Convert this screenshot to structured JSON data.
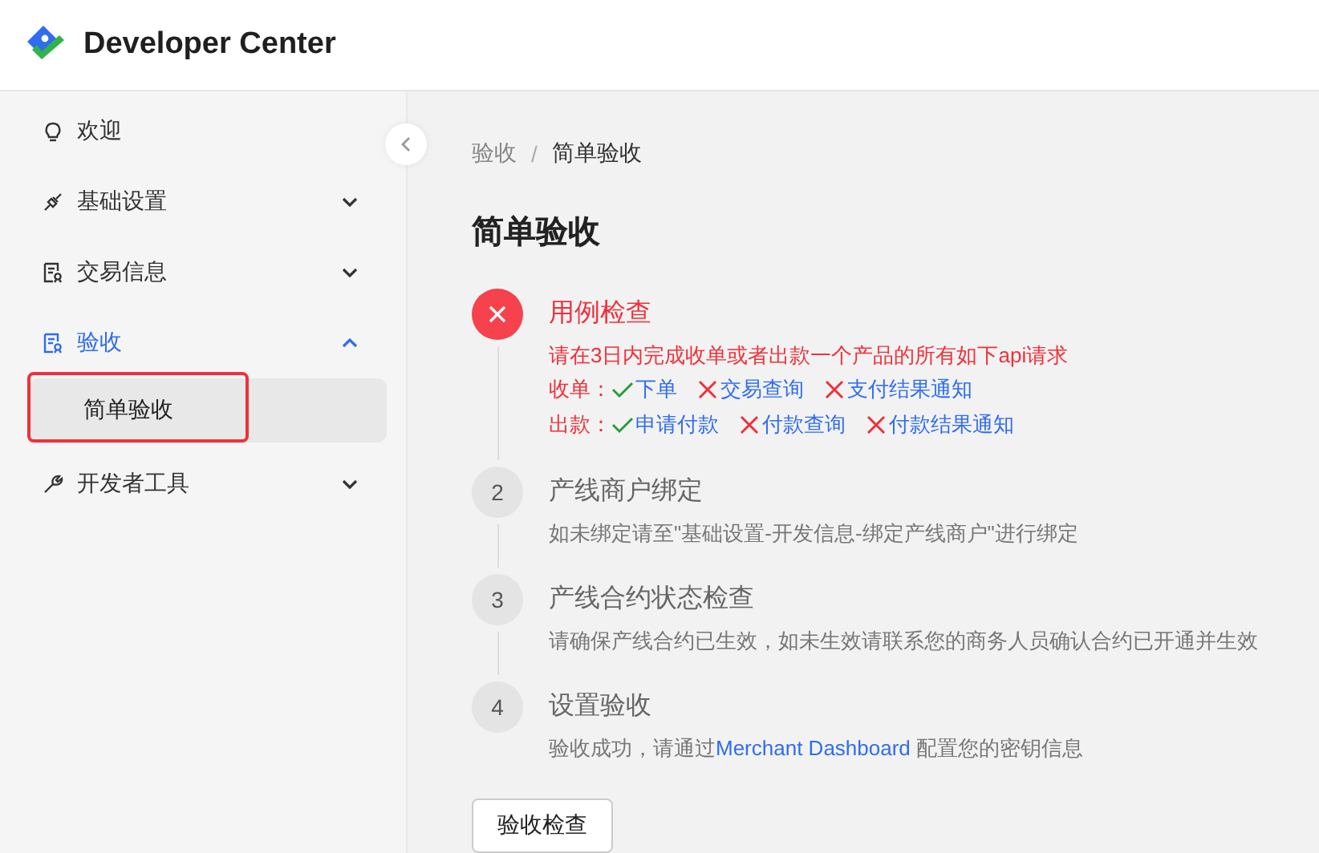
{
  "header": {
    "title": "Developer Center"
  },
  "sidebar": {
    "items": [
      {
        "label": "欢迎",
        "kind": "bulb",
        "selected": false
      },
      {
        "label": "基础设置",
        "kind": "plug",
        "selected": false,
        "expanded": false
      },
      {
        "label": "交易信息",
        "kind": "doc",
        "selected": false,
        "expanded": false
      },
      {
        "label": "验收",
        "kind": "doc",
        "selected": true,
        "expanded": true,
        "children": [
          {
            "label": "简单验收",
            "selected": true,
            "highlighted": true
          }
        ]
      },
      {
        "label": "开发者工具",
        "kind": "wrench",
        "selected": false,
        "expanded": false
      }
    ]
  },
  "breadcrumb": {
    "separator": "/",
    "items": [
      "验收",
      "简单验收"
    ]
  },
  "page_title": "简单验收",
  "steps": [
    {
      "kind": "error",
      "title": "用例检查",
      "description": "请在3日内完成收单或者出款一个产品的所有如下api请求",
      "checks": [
        {
          "label": "收单：",
          "items": [
            {
              "name": "下单",
              "done": true
            },
            {
              "name": "交易查询",
              "done": false
            },
            {
              "name": "支付结果通知",
              "done": false
            }
          ]
        },
        {
          "label": "出款：",
          "items": [
            {
              "name": "申请付款",
              "done": true
            },
            {
              "name": "付款查询",
              "done": false
            },
            {
              "name": "付款结果通知",
              "done": false
            }
          ]
        }
      ]
    },
    {
      "kind": "pending",
      "number": "2",
      "title": "产线商户绑定",
      "description": "如未绑定请至\"基础设置-开发信息-绑定产线商户\"进行绑定"
    },
    {
      "kind": "pending",
      "number": "3",
      "title": "产线合约状态检查",
      "description": "请确保产线合约已生效，如未生效请联系您的商务人员确认合约已开通并生效"
    },
    {
      "kind": "pending",
      "number": "4",
      "title": "设置验收",
      "description": "验收成功，请通过",
      "link": "Merchant Dashboard",
      "description_after": "配置您的密钥信息"
    }
  ],
  "button": "验收检查"
}
